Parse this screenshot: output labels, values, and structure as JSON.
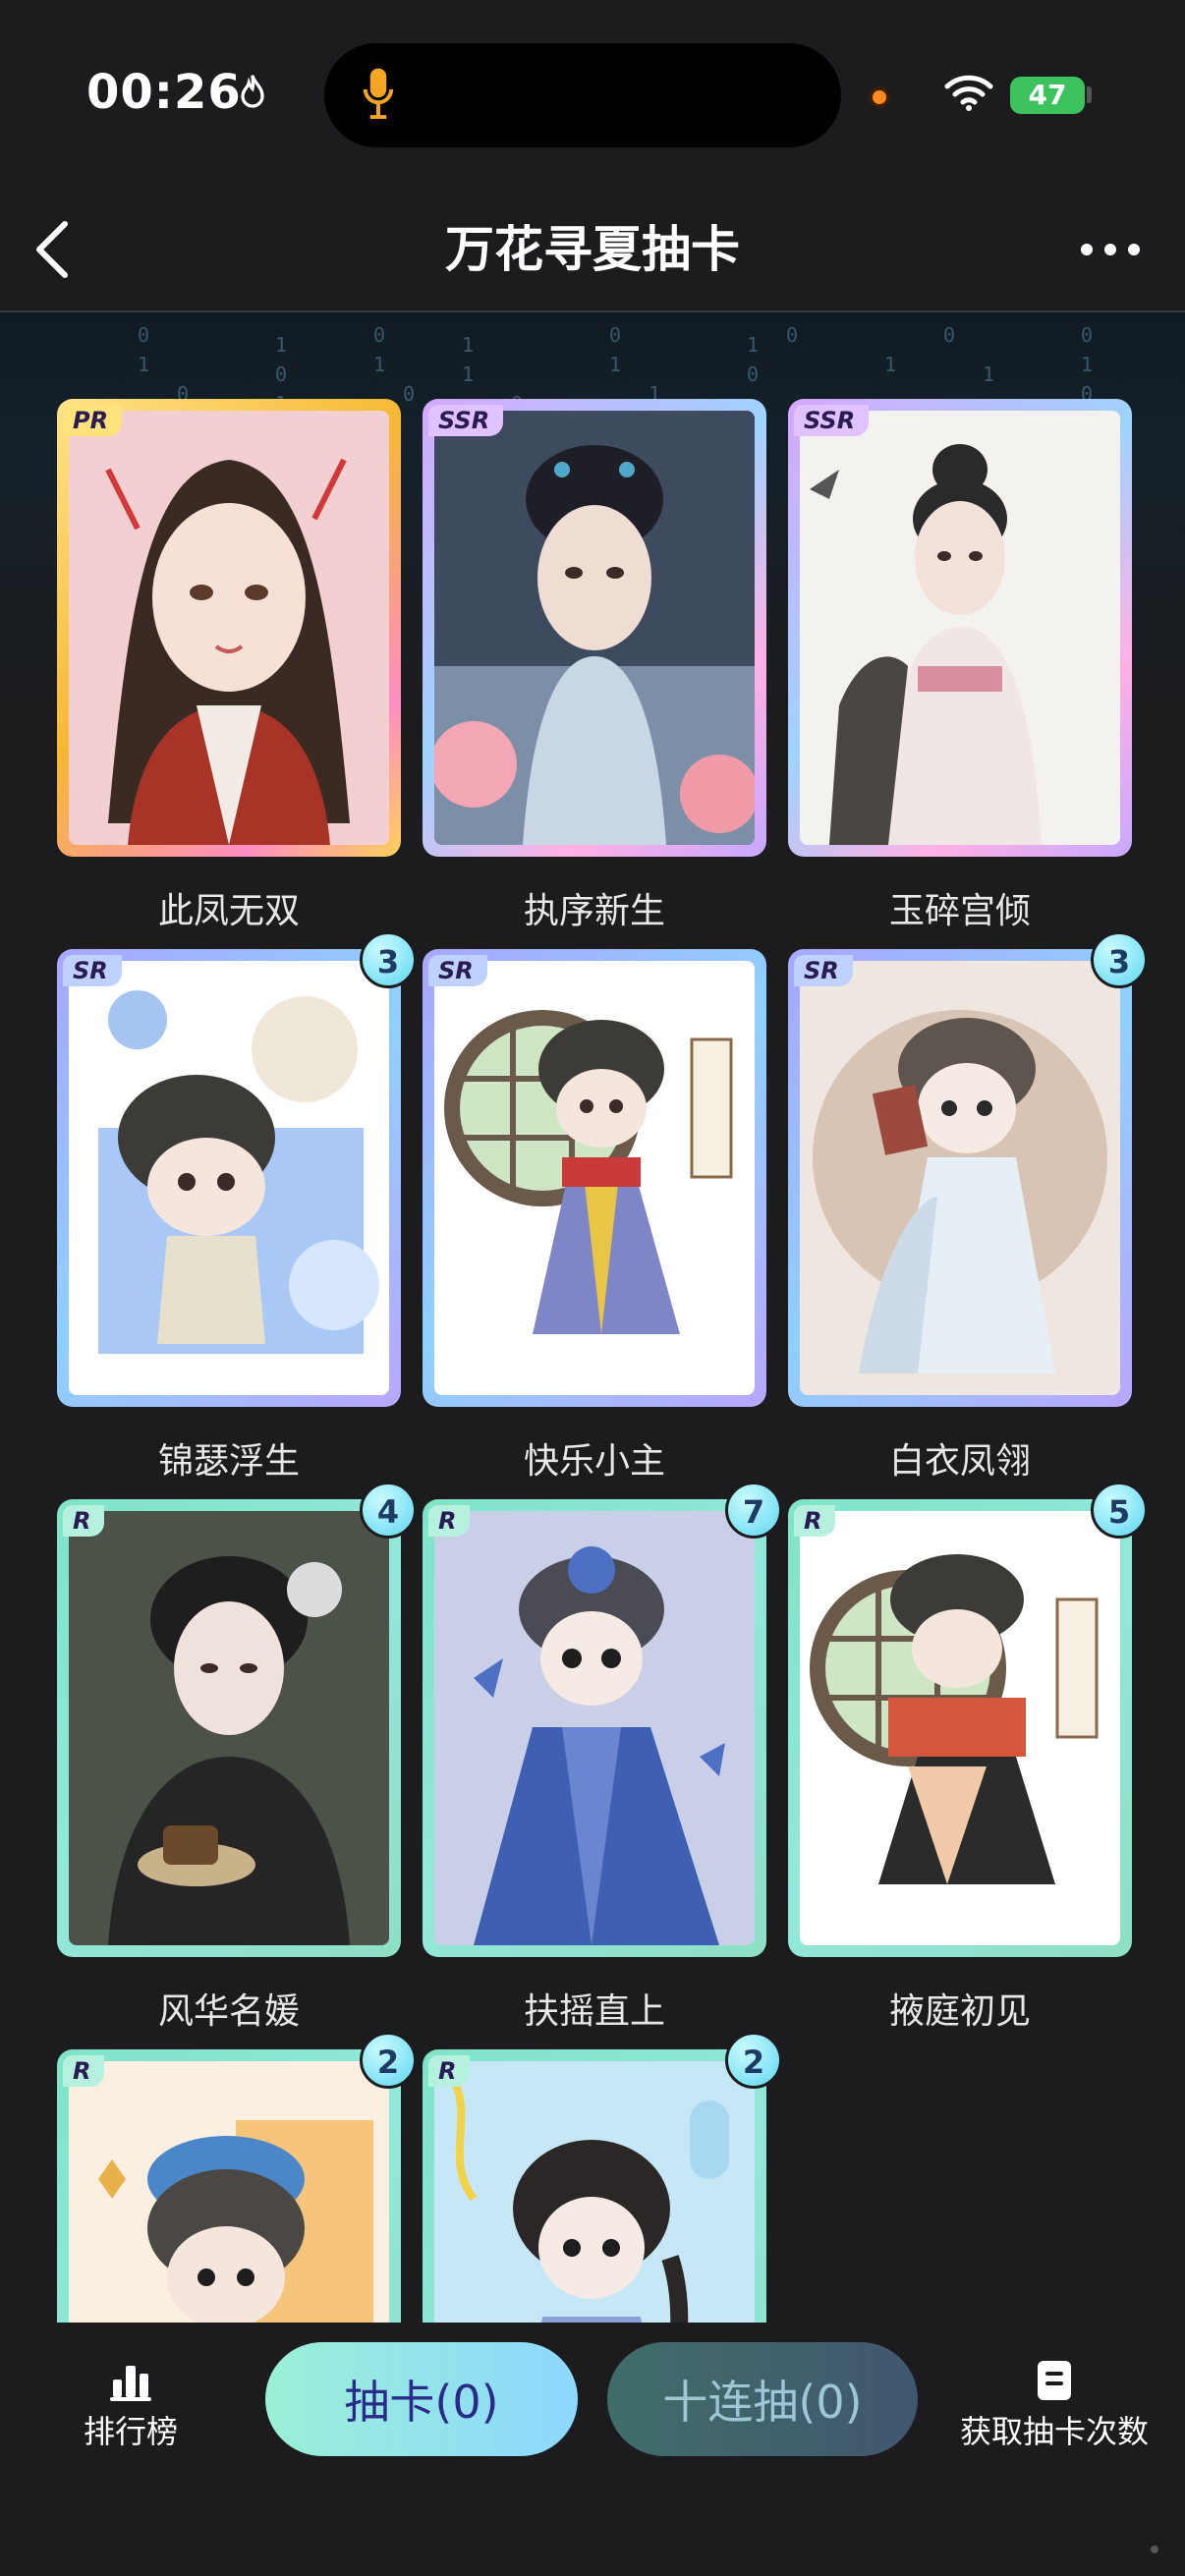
{
  "status_bar": {
    "time": "00:26",
    "battery": "47",
    "icons": [
      "flame-icon",
      "microphone-icon",
      "camera-indicator",
      "wifi-icon",
      "battery-icon"
    ]
  },
  "nav": {
    "title": "万花寻夏抽卡",
    "icons": [
      "back-chevron-icon",
      "more-icon"
    ]
  },
  "cards": [
    {
      "name": "此凤无双",
      "rarity": "PR",
      "count": null
    },
    {
      "name": "执序新生",
      "rarity": "SSR",
      "count": null
    },
    {
      "name": "玉碎宫倾",
      "rarity": "SSR",
      "count": null
    },
    {
      "name": "锦瑟浮生",
      "rarity": "SR",
      "count": "3"
    },
    {
      "name": "快乐小主",
      "rarity": "SR",
      "count": null
    },
    {
      "name": "白衣凤翎",
      "rarity": "SR",
      "count": "3"
    },
    {
      "name": "风华名媛",
      "rarity": "R",
      "count": "4"
    },
    {
      "name": "扶摇直上",
      "rarity": "R",
      "count": "7"
    },
    {
      "name": "掖庭初见",
      "rarity": "R",
      "count": "5"
    },
    {
      "name": "",
      "rarity": "R",
      "count": "2"
    },
    {
      "name": "",
      "rarity": "R",
      "count": "2"
    }
  ],
  "bottom_bar": {
    "ranking_label": "排行榜",
    "draw_label": "抽卡(0)",
    "ten_draw_label": "十连抽(0)",
    "get_draws_label": "获取抽卡次数"
  }
}
